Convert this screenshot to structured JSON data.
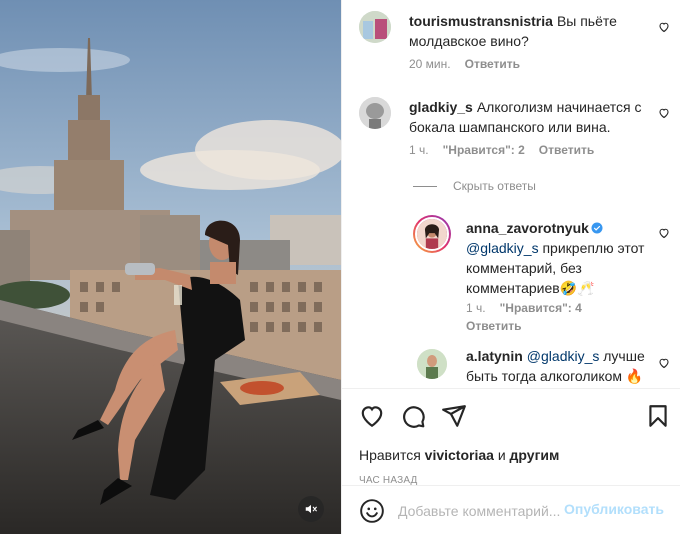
{
  "media": {
    "mute_icon": "speaker-muted-icon"
  },
  "comments": [
    {
      "username": "tourismustransnistria",
      "text": "Вы пьёте молдавское вино?",
      "time": "20 мин.",
      "reply_label": "Ответить"
    },
    {
      "username": "gladkiy_s",
      "text": "Алкоголизм начинается с бокала шампанского или вина.",
      "time": "1 ч.",
      "likes_label": "\"Нравится\": 2",
      "reply_label": "Ответить"
    }
  ],
  "hide_replies_label": "Скрыть ответы",
  "replies": [
    {
      "username": "anna_zavorotnyuk",
      "verified": true,
      "mention": "@gladkiy_s",
      "text": " прикреплю этот комментарий, без комментариев🤣🥂",
      "time": "1 ч.",
      "likes_label": "\"Нравится\": 4",
      "reply_label": "Ответить"
    },
    {
      "username": "a.latynin",
      "mention": "@gladkiy_s",
      "text": " лучше быть тогда алкоголиком 🔥"
    }
  ],
  "likes": {
    "prefix": "Нравится",
    "user": "vivictoriaa",
    "conjunction": "и",
    "others": "другим"
  },
  "time_ago": "ЧАС НАЗАД",
  "add_comment": {
    "placeholder": "Добавьте комментарий...",
    "post_label": "Опубликовать"
  },
  "colors": {
    "link": "#00376b",
    "muted": "#8e8e8e",
    "post_disabled": "#b2dffc",
    "verified": "#3897f0"
  }
}
